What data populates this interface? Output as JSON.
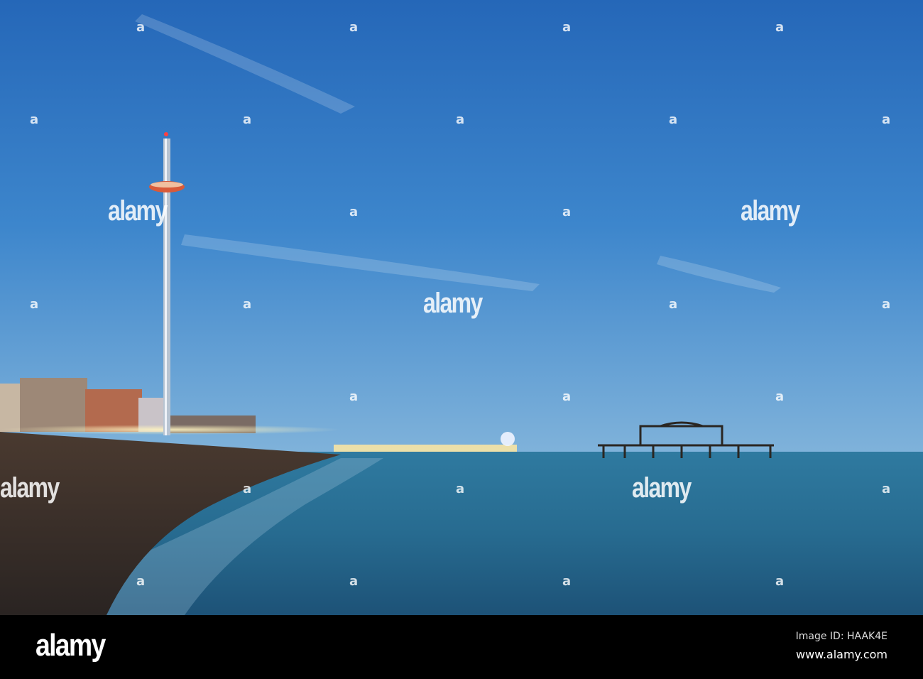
{
  "watermark": {
    "brand": "alamy",
    "dot_glyph": "a"
  },
  "footer": {
    "logo": "alamy",
    "image_id": "Image ID: HAAK4E",
    "site": "www.alamy.com"
  },
  "colors": {
    "sky_top": "#2567b8",
    "horizon": "#7fb2da",
    "sea": "#2a6e92",
    "beach": "#3a2f2a"
  }
}
